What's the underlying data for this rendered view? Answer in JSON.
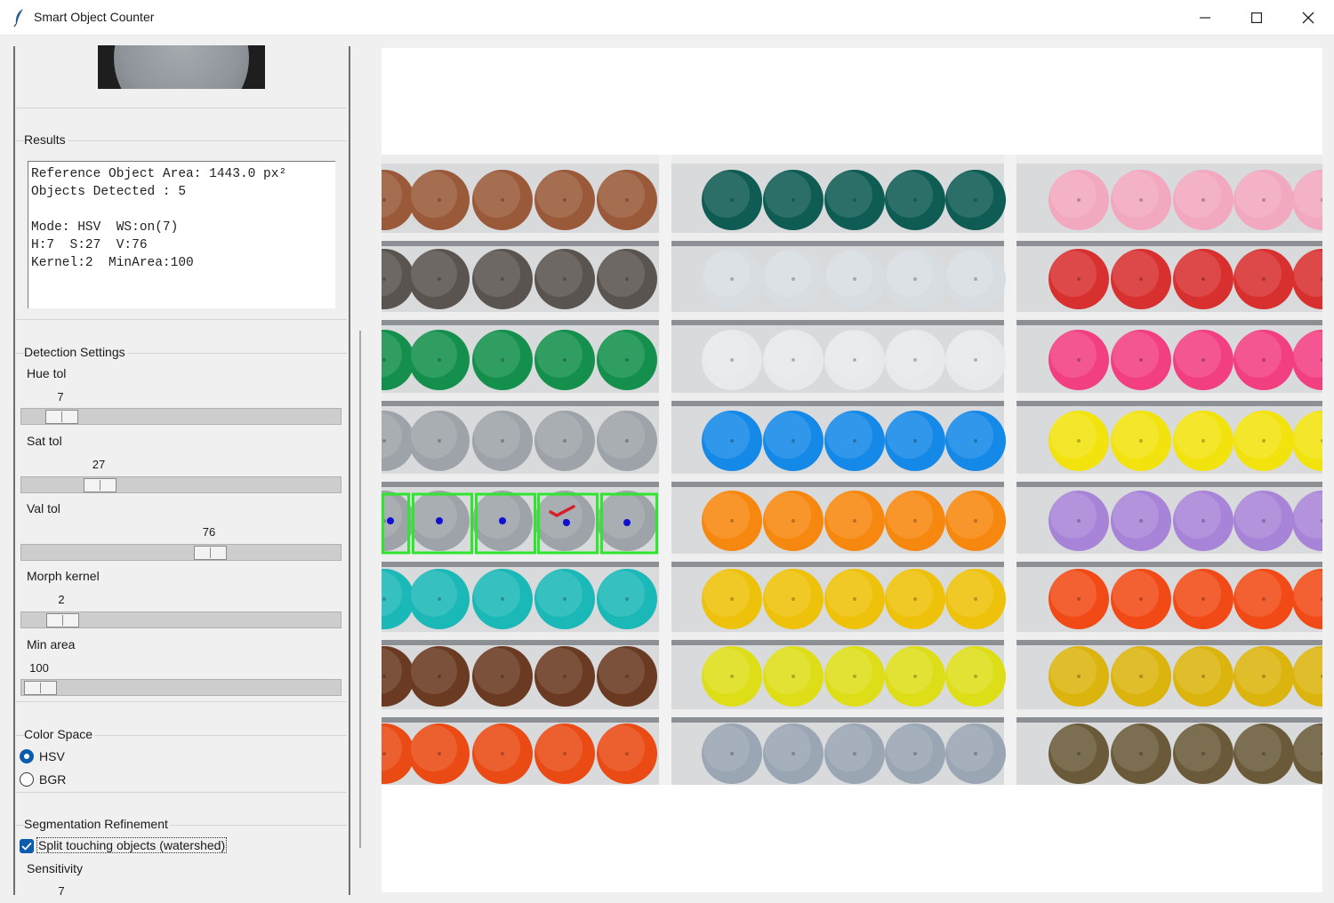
{
  "window": {
    "title": "Smart Object Counter"
  },
  "results": {
    "frame_label": "Results",
    "lines": [
      "Reference Object Area: 1443.0 px²",
      "Objects Detected : 5",
      "",
      "Mode: HSV  WS:on(7)",
      "H:7  S:27  V:76",
      "Kernel:2  MinArea:100"
    ]
  },
  "detection": {
    "frame_label": "Detection Settings",
    "hue": {
      "label": "Hue tol",
      "value": "7"
    },
    "sat": {
      "label": "Sat tol",
      "value": "27"
    },
    "val": {
      "label": "Val tol",
      "value": "76"
    },
    "kernel": {
      "label": "Morph kernel",
      "value": "2"
    },
    "min_area": {
      "label": "Min area",
      "value": "100"
    }
  },
  "color_space": {
    "frame_label": "Color Space",
    "options": [
      "HSV",
      "BGR"
    ],
    "selected": "HSV"
  },
  "segmentation": {
    "frame_label": "Segmentation Refinement",
    "watershed_label": "Split touching objects (watershed)",
    "watershed_checked": true,
    "sensitivity_label": "Sensitivity",
    "sensitivity_value": "7"
  },
  "colors": {
    "detection_box": "#2ee62e",
    "centroid": "#1010d0",
    "reference_mark": "#d8202a",
    "accent": "#0b5cad"
  }
}
